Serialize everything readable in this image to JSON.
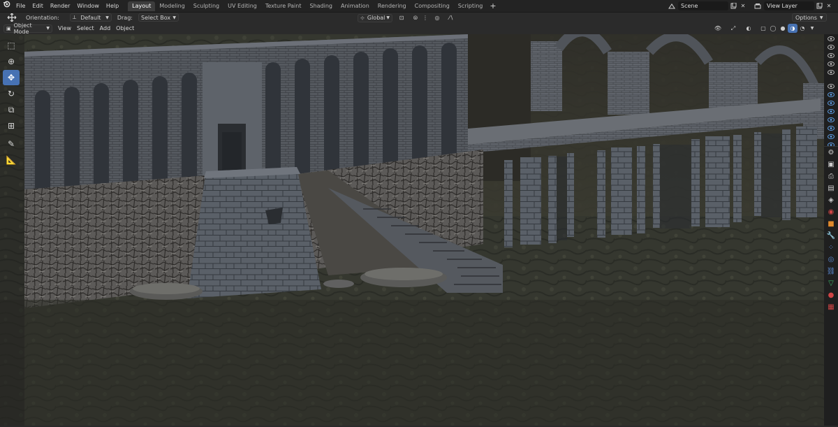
{
  "menus": [
    "File",
    "Edit",
    "Render",
    "Window",
    "Help"
  ],
  "workspaces": [
    "Layout",
    "Modeling",
    "Sculpting",
    "UV Editing",
    "Texture Paint",
    "Shading",
    "Animation",
    "Rendering",
    "Compositing",
    "Scripting"
  ],
  "active_workspace": "Layout",
  "add_workspace": "+",
  "scene": {
    "value": "Scene"
  },
  "view_layer": {
    "value": "View Layer"
  },
  "header": {
    "orientation_label": "Orientation:",
    "orientation_value": "Default",
    "drag_label": "Drag:",
    "drag_value": "Select Box",
    "transform_orientation": "Global",
    "options": "Options"
  },
  "viewport_header": {
    "mode": "Object Mode",
    "menus": [
      "View",
      "Select",
      "Add",
      "Object"
    ]
  },
  "tools": [
    "select-box-icon",
    "cursor-icon",
    "move-icon",
    "rotate-icon",
    "scale-icon",
    "transform-icon",
    "annotate-icon",
    "measure-icon"
  ],
  "active_tool": "move-icon",
  "property_tabs": [
    "tool-icon",
    "render-icon",
    "output-icon",
    "view-layer-icon",
    "scene-icon",
    "world-icon",
    "object-icon",
    "modifier-icon",
    "particles-icon",
    "physics-icon",
    "constraints-icon",
    "data-icon",
    "material-icon",
    "texture-icon"
  ],
  "colors": {
    "accent": "#4772b3",
    "eye": "#5fa0e8"
  }
}
